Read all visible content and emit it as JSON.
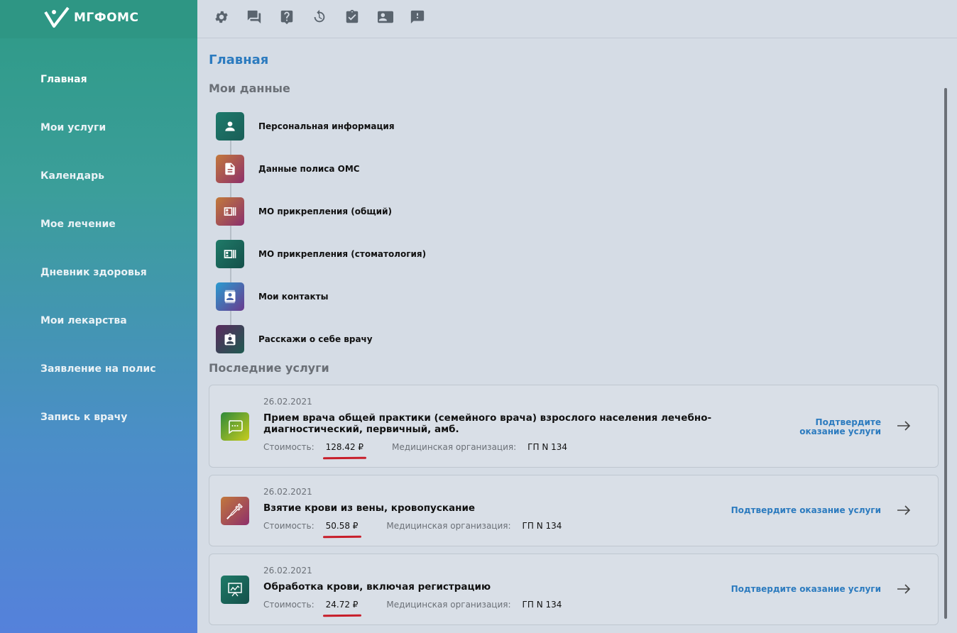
{
  "app": {
    "logo_text": "МГФОМС"
  },
  "sidebar": {
    "items": [
      {
        "label": "Главная"
      },
      {
        "label": "Мои услуги"
      },
      {
        "label": "Календарь"
      },
      {
        "label": "Мое лечение"
      },
      {
        "label": "Дневник здоровья"
      },
      {
        "label": "Мои лекарства"
      },
      {
        "label": "Заявление на полис"
      },
      {
        "label": "Запись к врачу"
      }
    ]
  },
  "topbar": {
    "icons": [
      "gear-icon",
      "chat-icon",
      "help-icon",
      "history-icon",
      "clipboard-check-icon",
      "contact-card-icon",
      "feedback-icon"
    ]
  },
  "main": {
    "title": "Главная",
    "my_data_title": "Мои данные",
    "my_data_items": [
      {
        "label": "Персональная информация",
        "icon": "person-icon"
      },
      {
        "label": "Данные полиса ОМС",
        "icon": "document-icon"
      },
      {
        "label": "МО прикрепления (общий)",
        "icon": "id-card-icon"
      },
      {
        "label": "МО прикрепления (стоматология)",
        "icon": "id-card-icon"
      },
      {
        "label": "Мои контакты",
        "icon": "contacts-icon"
      },
      {
        "label": "Расскажи о себе врачу",
        "icon": "badge-icon"
      }
    ],
    "recent_title": "Последние услуги",
    "services": [
      {
        "date": "26.02.2021",
        "name": "Прием врача общей практики (семейного врача) взрослого населения лечебно-диагностический, первичный, амб.",
        "cost_label": "Стоимость:",
        "cost": "128.42 ₽",
        "org_label": "Медицинская организация:",
        "org": "ГП N 134",
        "confirm": "Подтвердите оказание услуги",
        "icon": "chat-bubble-icon"
      },
      {
        "date": "26.02.2021",
        "name": "Взятие крови из вены, кровопускание",
        "cost_label": "Стоимость:",
        "cost": "50.58 ₽",
        "org_label": "Медицинская организация:",
        "org": "ГП N 134",
        "confirm": "Подтвердите оказание услуги",
        "icon": "syringe-icon"
      },
      {
        "date": "26.02.2021",
        "name": "Обработка крови, включая регистрацию",
        "cost_label": "Стоимость:",
        "cost": "24.72 ₽",
        "org_label": "Медицинская организация:",
        "org": "ГП N 134",
        "confirm": "Подтвердите оказание услуги",
        "icon": "monitor-chart-icon"
      }
    ]
  },
  "colors": {
    "accent": "#2c7bbf",
    "sidebar_top": "#2e9684",
    "underline": "#c81e2a"
  }
}
